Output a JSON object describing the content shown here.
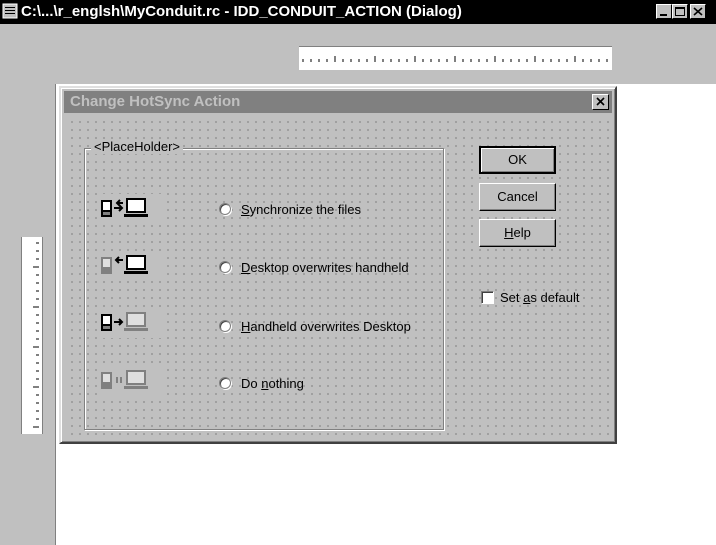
{
  "window": {
    "title": "C:\\...\\r_englsh\\MyConduit.rc - IDD_CONDUIT_ACTION (Dialog)",
    "icon": "document-icon",
    "controls": [
      "minimize",
      "maximize",
      "close"
    ]
  },
  "dialog": {
    "title": "Change HotSync Action",
    "group_label": "<PlaceHolder>",
    "options": [
      {
        "pre": "",
        "key": "S",
        "post": "ynchronize the files",
        "icon": "sync-both-icon"
      },
      {
        "pre": "",
        "key": "D",
        "post": "esktop overwrites handheld",
        "icon": "desktop-to-handheld-icon"
      },
      {
        "pre": "",
        "key": "H",
        "post": "andheld overwrites Desktop",
        "icon": "handheld-to-desktop-icon"
      },
      {
        "pre": "Do ",
        "key": "n",
        "post": "othing",
        "icon": "do-nothing-icon"
      }
    ],
    "buttons": {
      "ok": "OK",
      "cancel": "Cancel",
      "help_key": "H",
      "help_rest": "elp"
    },
    "default_checkbox": {
      "pre": "Set ",
      "key": "a",
      "post": "s default",
      "checked": false
    }
  },
  "colors": {
    "window_title_bg": "#000000",
    "dialog_title_bg": "#808080",
    "face": "#c0c0c0"
  }
}
